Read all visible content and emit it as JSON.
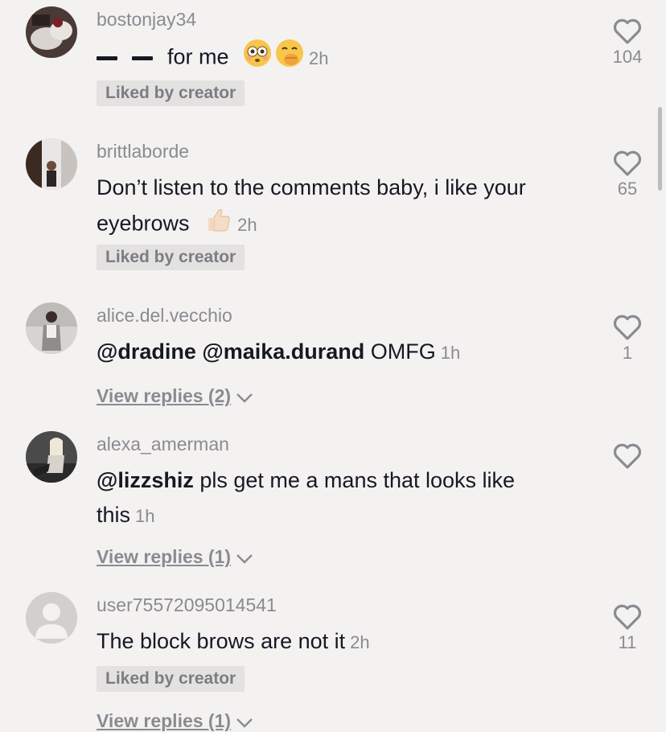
{
  "comments": [
    {
      "username": "bostonjay34",
      "text": "for me",
      "prefix_dashes": true,
      "emojis": [
        "flushed-face",
        "face-with-hand-over-mouth"
      ],
      "time": "2h",
      "liked_by_creator": "Liked by creator",
      "like_count": "104"
    },
    {
      "username": "brittlaborde",
      "text_line1": "Don’t listen to the comments baby, i like your",
      "text_line2": "eyebrows",
      "emojis": [
        "thumbs-up"
      ],
      "time": "2h",
      "liked_by_creator": "Liked by creator",
      "like_count": "65"
    },
    {
      "username": "alice.del.vecchio",
      "mentions": [
        "@dradine",
        "@maika.durand"
      ],
      "text": "OMFG",
      "time": "1h",
      "view_replies": "View replies (2)",
      "like_count": "1"
    },
    {
      "username": "alexa_amerman",
      "mentions": [
        "@lizzshiz"
      ],
      "text_line1": "pls get me a mans that looks like",
      "text_line2": "this",
      "time": "1h",
      "view_replies": "View replies (1)",
      "like_count": ""
    },
    {
      "username": "user75572095014541",
      "text": "The block brows are not it",
      "time": "2h",
      "liked_by_creator": "Liked by creator",
      "view_replies": "View replies (1)",
      "like_count": "11"
    }
  ],
  "colors": {
    "background": "#f4f2f1",
    "primary_text": "#161823",
    "secondary_text": "#8a8b91",
    "badge_background": "#e3e2e1"
  }
}
